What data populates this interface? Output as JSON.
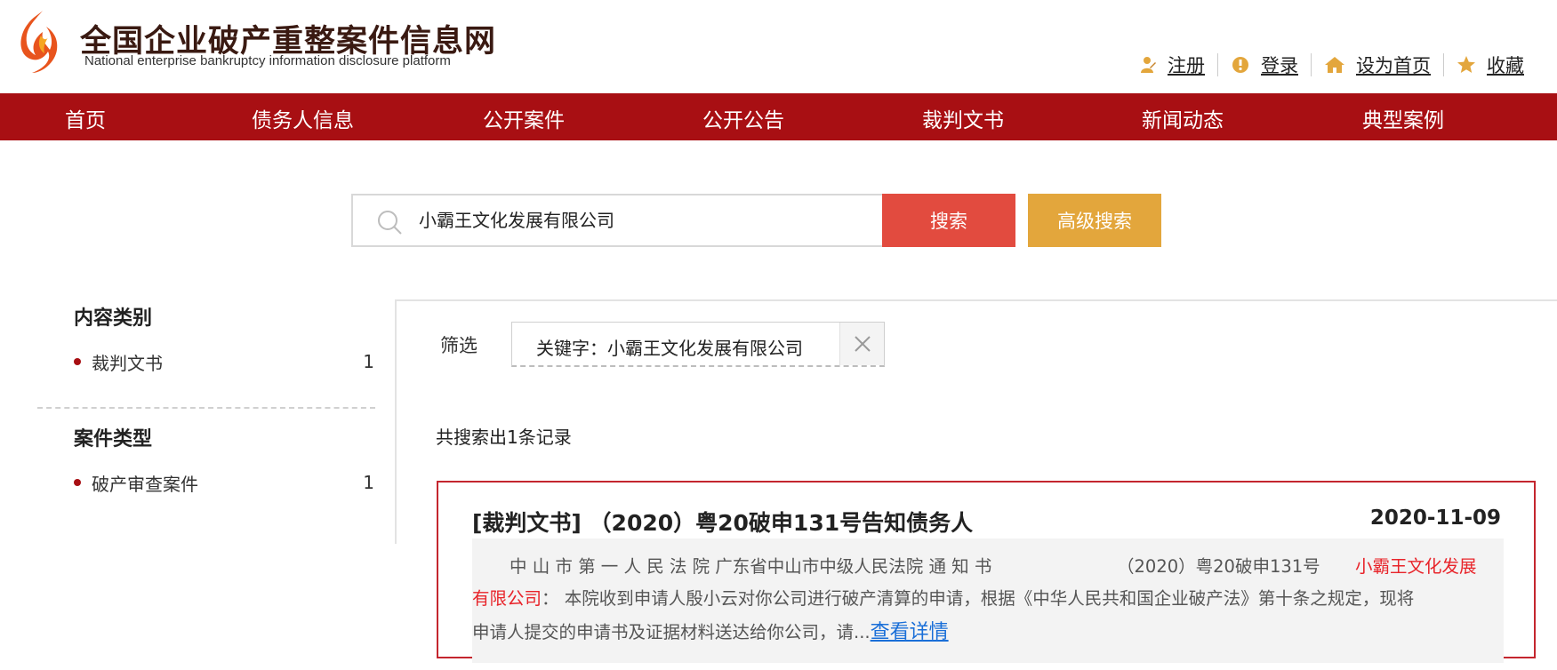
{
  "header": {
    "site_title_cn": "全国企业破产重整案件信息网",
    "site_title_en": "National enterprise bankruptcy  information disclosure platform",
    "links": [
      {
        "label": "注册",
        "icon": "register-icon"
      },
      {
        "label": "登录",
        "icon": "login-icon"
      },
      {
        "label": "设为首页",
        "icon": "home-icon"
      },
      {
        "label": "收藏",
        "icon": "star-icon"
      }
    ]
  },
  "nav": {
    "items": [
      "首页",
      "债务人信息",
      "公开案件",
      "公开公告",
      "裁判文书",
      "新闻动态",
      "典型案例"
    ]
  },
  "search": {
    "value": "小霸王文化发展有限公司",
    "button": "搜索",
    "advanced_button": "高级搜索"
  },
  "sidebar": {
    "content_heading": "内容类别",
    "content_items": [
      {
        "label": "裁判文书",
        "count": "1"
      }
    ],
    "case_heading": "案件类型",
    "case_items": [
      {
        "label": "破产审查案件",
        "count": "1"
      }
    ]
  },
  "filter": {
    "label": "筛选",
    "chip": "关键字：小霸王文化发展有限公司"
  },
  "results": {
    "summary": "共搜索出1条记录",
    "items": [
      {
        "title": "[裁判文书] （2020）粤20破申131号告知债务人",
        "date": "2020-11-09",
        "line1_a": "中 山 市 第 一 人 民 法 院 广东省中山市中级人民法院 通 知 书",
        "line1_b": "（2020）粤20破申131号",
        "highlight_a": "小霸王文化发展",
        "highlight_b": "有限公司",
        "line2_rest": "：  本院收到申请人殷小云对你公司进行破产清算的申请，根据《中华人民共和国企业破产法》第十条之规定，现将",
        "line3": "申请人提交的申请书及证据材料送达给你公司，请...",
        "more_link": "查看详情"
      }
    ]
  },
  "colors": {
    "nav_bg": "#a80f13",
    "search_button": "#e24b3f",
    "advanced_button": "#e3a63c",
    "highlight": "#e8242a",
    "link": "#1a6fd8"
  }
}
